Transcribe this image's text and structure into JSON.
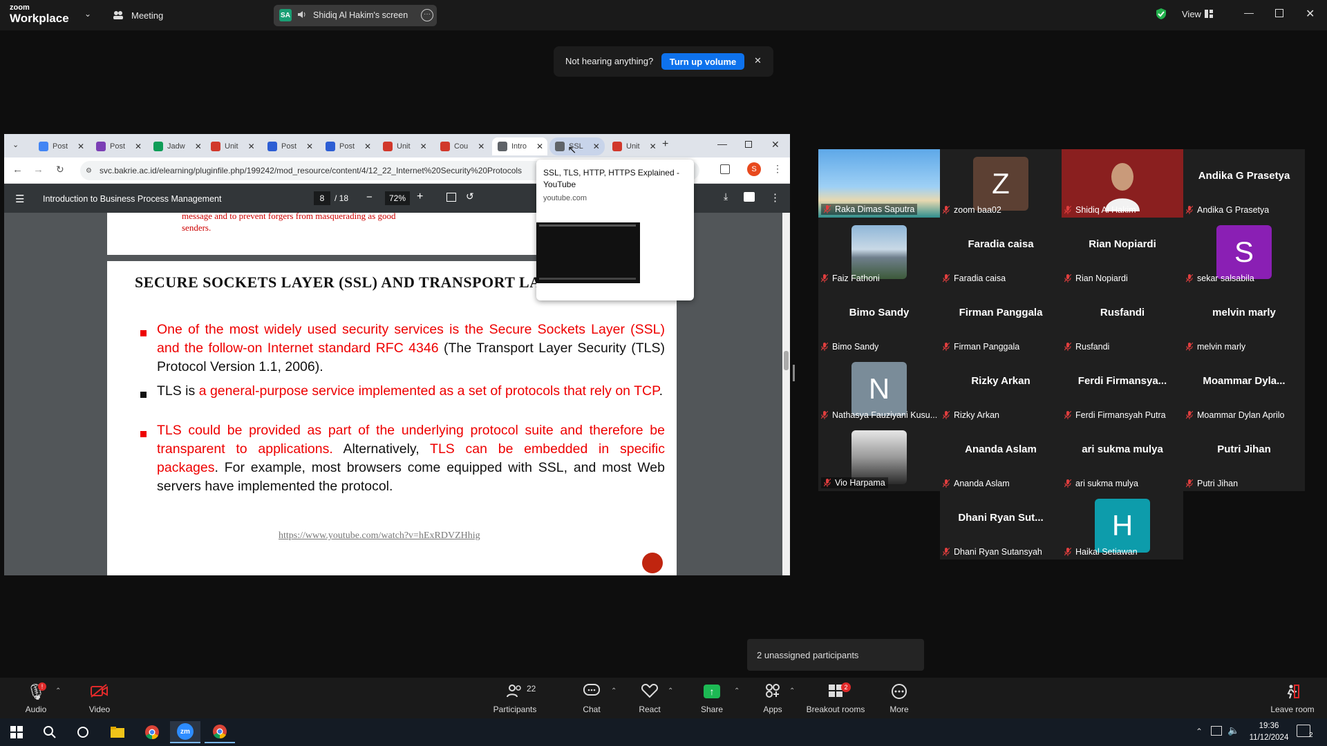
{
  "titlebar": {
    "brand_top": "zoom",
    "brand_bottom": "Workplace",
    "meeting_label": "Meeting",
    "share_badge": "SA",
    "share_label": "Shidiq Al Hakim's screen",
    "view_label": "View"
  },
  "notification": {
    "text": "Not hearing anything?",
    "button": "Turn up volume",
    "close": "✕"
  },
  "browser": {
    "tabs": [
      {
        "label": "Post",
        "icon_color": "#4285f4"
      },
      {
        "label": "Post",
        "icon_color": "#7b3fb5"
      },
      {
        "label": "Jadw",
        "icon_color": "#0f9d58"
      },
      {
        "label": "Unit",
        "icon_color": "#d1382b"
      },
      {
        "label": "Post",
        "icon_color": "#2d5ed4"
      },
      {
        "label": "Post",
        "icon_color": "#2d5ed4"
      },
      {
        "label": "Unit",
        "icon_color": "#d1382b"
      },
      {
        "label": "Cou",
        "icon_color": "#d1382b"
      },
      {
        "label": "Intro",
        "icon_color": "#5f6368"
      },
      {
        "label": "SSL",
        "icon_color": "#5f6368"
      },
      {
        "label": "Unit",
        "icon_color": "#d1382b"
      }
    ],
    "url": "svc.bakrie.ac.id/elearning/pluginfile.php/199242/mod_resource/content/4/12_22_Internet%20Security%20Protocols",
    "profile_letter": "S"
  },
  "pdf": {
    "title": "Introduction to Business Process Management",
    "page_current": "8",
    "page_total": "/ 18",
    "zoom": "72%",
    "prev_fragment_line1": "message and to prevent forgers from masquerading as good",
    "prev_fragment_line2": "senders.",
    "slide_title": "SECURE SOCKETS LAYER (SSL) AND TRANSPORT LAYER SECURITY",
    "bullet1_red": "One of the most widely used security services is the Secure Sockets Layer (SSL) and the follow-on Internet standard RFC 4346",
    "bullet1_black": " (The Transport Layer Security (TLS) Protocol Version 1.1, 2006).",
    "bullet2_black": "TLS is ",
    "bullet2_red": "a general-purpose service implemented as a set of protocols that rely on TCP",
    "bullet2_end": ".",
    "bullet3_red1": "TLS could be provided as part of the underlying protocol suite and therefore be transparent to applications.",
    "bullet3_black1": " Alternatively, ",
    "bullet3_red2": "TLS can be embedded in specific packages",
    "bullet3_black2": ". For example, most browsers come equipped with SSL, and most Web servers have implemented the protocol.",
    "link": "https://www.youtube.com/watch?v=hExRDVZHhig"
  },
  "hover_card": {
    "title": "SSL, TLS, HTTP, HTTPS Explained - YouTube",
    "domain": "youtube.com"
  },
  "gallery": {
    "tiles": [
      {
        "name": "Raka Dimas Saputra",
        "big": "",
        "avatar": "photo-beach"
      },
      {
        "name": "zoom baa02",
        "big": "",
        "avatar": "Z",
        "avatar_color": "#5c4033"
      },
      {
        "name": "Shidiq Al Hakim",
        "big": "",
        "avatar": "video",
        "active": true
      },
      {
        "name": "Andika G Prasetya",
        "big": "Andika G Prasetya"
      },
      {
        "name": "Faiz Fathoni",
        "big": "",
        "avatar": "photo-building"
      },
      {
        "name": "Faradia caisa",
        "big": "Faradia caisa"
      },
      {
        "name": "Rian Nopiardi",
        "big": "Rian Nopiardi"
      },
      {
        "name": "sekar salsabila",
        "big": "",
        "avatar": "S",
        "avatar_color": "#8a1fb4"
      },
      {
        "name": "Bimo Sandy",
        "big": "Bimo Sandy"
      },
      {
        "name": "Firman Panggala",
        "big": "Firman Panggala"
      },
      {
        "name": "Rusfandi",
        "big": "Rusfandi"
      },
      {
        "name": "melvin marly",
        "big": "melvin marly"
      },
      {
        "name": "Nathasya Fauziyani Kusu...",
        "big": "",
        "avatar": "N",
        "avatar_color": "#7a8c99"
      },
      {
        "name": "Rizky Arkan",
        "big": "Rizky Arkan"
      },
      {
        "name": "Ferdi Firmansyah Putra",
        "big": "Ferdi  Firmansya..."
      },
      {
        "name": "Moammar Dylan Aprilo",
        "big": "Moammar  Dyla..."
      },
      {
        "name": "Vio Harpama",
        "big": "",
        "avatar": "photo-bw"
      },
      {
        "name": "Ananda Aslam",
        "big": "Ananda Aslam"
      },
      {
        "name": "ari sukma mulya",
        "big": "ari sukma mulya"
      },
      {
        "name": "Putri Jihan",
        "big": "Putri Jihan"
      },
      {
        "name": "Dhani Ryan Sutansyah",
        "big": "Dhani  Ryan  Sut..."
      },
      {
        "name": "Haikal Setiawan",
        "big": "",
        "avatar": "H",
        "avatar_color": "#0d9cab"
      }
    ]
  },
  "unassigned": "2 unassigned participants",
  "toolbar": {
    "audio": "Audio",
    "video": "Video",
    "participants": "Participants",
    "participants_count": "22",
    "chat": "Chat",
    "react": "React",
    "share": "Share",
    "apps": "Apps",
    "breakout": "Breakout rooms",
    "breakout_badge": "2",
    "more": "More",
    "leave": "Leave room",
    "audio_badge": "!"
  },
  "taskbar": {
    "time": "19:36",
    "date": "11/12/2024",
    "notif_count": "2"
  },
  "colors": {
    "accent": "#0e72ed",
    "share_green": "#1a9f74",
    "pdf_red": "#e00000",
    "active_tile": "#2ecc71"
  }
}
